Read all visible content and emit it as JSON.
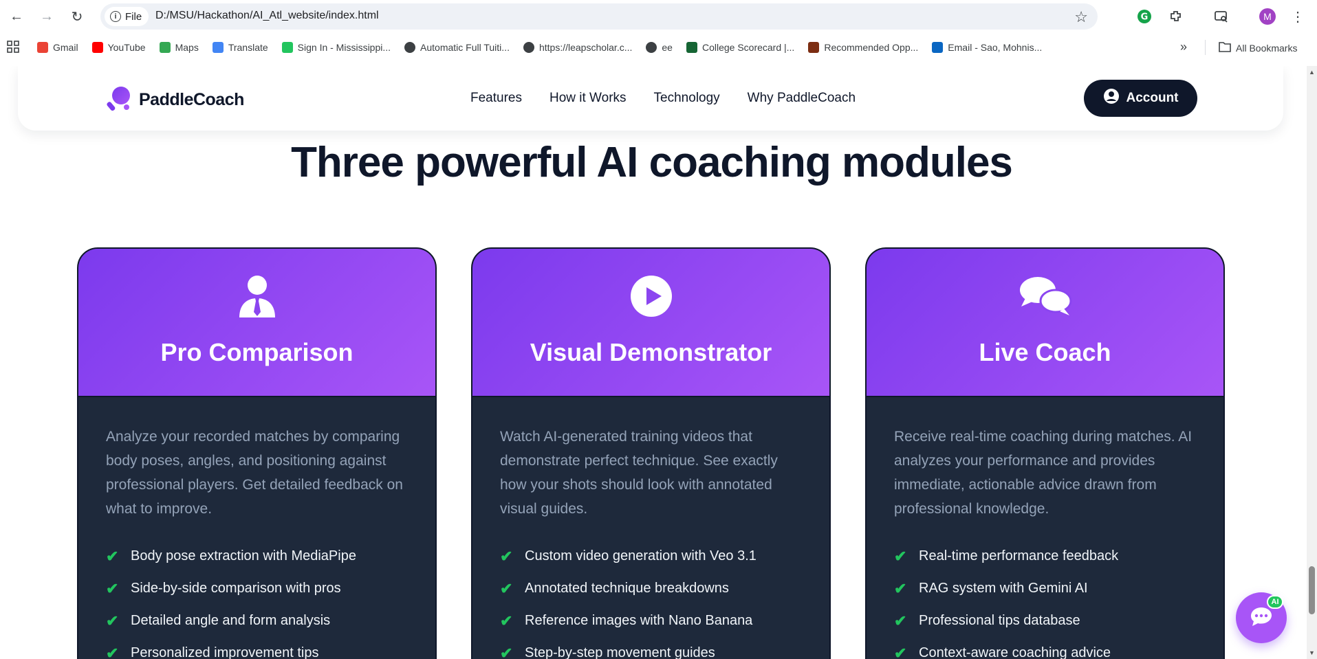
{
  "browser": {
    "site_info_label": "File",
    "url": "D:/MSU/Hackathon/AI_Atl_website/index.html",
    "profile_initial": "M",
    "bookmarks": [
      {
        "label": "Gmail",
        "icon": "gmail-icon",
        "color": "#ea4335"
      },
      {
        "label": "YouTube",
        "icon": "youtube-icon",
        "color": "#ff0000"
      },
      {
        "label": "Maps",
        "icon": "maps-icon",
        "color": "#34a853"
      },
      {
        "label": "Translate",
        "icon": "translate-icon",
        "color": "#4285f4"
      },
      {
        "label": "Sign In - Mississippi...",
        "icon": "signin-icon",
        "color": "#22c55e"
      },
      {
        "label": "Automatic Full Tuiti...",
        "icon": "globe-icon",
        "color": "#3c4043"
      },
      {
        "label": "https://leapscholar.c...",
        "icon": "globe-icon",
        "color": "#3c4043"
      },
      {
        "label": "ee",
        "icon": "globe-icon",
        "color": "#3c4043"
      },
      {
        "label": "College Scorecard |...",
        "icon": "scorecard-icon",
        "color": "#166534"
      },
      {
        "label": "Recommended Opp...",
        "icon": "star-bookmark-icon",
        "color": "#7c2d12"
      },
      {
        "label": "Email - Sao, Mohnis...",
        "icon": "outlook-icon",
        "color": "#0a66c2"
      }
    ],
    "all_bookmarks_label": "All Bookmarks",
    "more_symbol": "»"
  },
  "header": {
    "logo_text": "PaddleCoach",
    "nav": [
      "Features",
      "How it Works",
      "Technology",
      "Why PaddleCoach"
    ],
    "account_label": "Account"
  },
  "section": {
    "title": "Three powerful AI coaching modules"
  },
  "cards": [
    {
      "icon": "user-tie-icon",
      "title": "Pro Comparison",
      "description": "Analyze your recorded matches by comparing body poses, angles, and positioning against professional players. Get detailed feedback on what to improve.",
      "features": [
        "Body pose extraction with MediaPipe",
        "Side-by-side comparison with pros",
        "Detailed angle and form analysis",
        "Personalized improvement tips"
      ]
    },
    {
      "icon": "play-circle-icon",
      "title": "Visual Demonstrator",
      "description": "Watch AI-generated training videos that demonstrate perfect technique. See exactly how your shots should look with annotated visual guides.",
      "features": [
        "Custom video generation with Veo 3.1",
        "Annotated technique breakdowns",
        "Reference images with Nano Banana",
        "Step-by-step movement guides"
      ]
    },
    {
      "icon": "chat-bubbles-icon",
      "title": "Live Coach",
      "description": "Receive real-time coaching during matches. AI analyzes your performance and provides immediate, actionable advice drawn from professional knowledge.",
      "features": [
        "Real-time performance feedback",
        "RAG system with Gemini AI",
        "Professional tips database",
        "Context-aware coaching advice"
      ]
    }
  ],
  "chat_widget": {
    "badge": "AI"
  },
  "colors": {
    "accent": "#7c3aed",
    "accent_light": "#a855f7",
    "dark": "#0f172a",
    "card_body": "#1e293b",
    "check": "#22c55e"
  }
}
